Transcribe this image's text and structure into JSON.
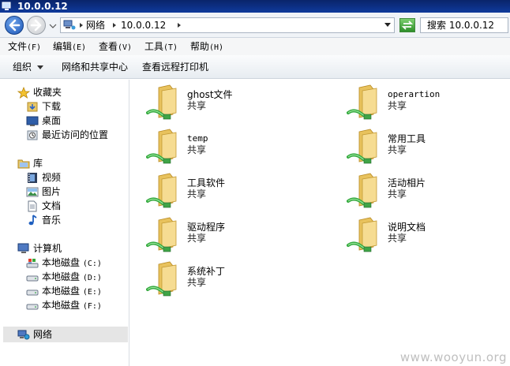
{
  "window": {
    "title": "10.0.0.12"
  },
  "address": {
    "crumbs": [
      "网络",
      "10.0.0.12"
    ],
    "search_text": "搜索 10.0.0.12"
  },
  "menu": [
    {
      "label": "文件",
      "key": "(F)"
    },
    {
      "label": "编辑",
      "key": "(E)"
    },
    {
      "label": "查看",
      "key": "(V)"
    },
    {
      "label": "工具",
      "key": "(T)"
    },
    {
      "label": "帮助",
      "key": "(H)"
    }
  ],
  "commands": {
    "organize": "组织",
    "network_center": "网络和共享中心",
    "remote_printers": "查看远程打印机"
  },
  "nav": {
    "favorites": {
      "label": "收藏夹",
      "items": [
        "下载",
        "桌面",
        "最近访问的位置"
      ]
    },
    "libraries": {
      "label": "库",
      "items": [
        "视频",
        "图片",
        "文档",
        "音乐"
      ]
    },
    "computer": {
      "label": "计算机",
      "items": [
        {
          "name": "本地磁盘",
          "drive": "(C:)"
        },
        {
          "name": "本地磁盘",
          "drive": "(D:)"
        },
        {
          "name": "本地磁盘",
          "drive": "(E:)"
        },
        {
          "name": "本地磁盘",
          "drive": "(F:)"
        }
      ]
    },
    "network": {
      "label": "网络"
    }
  },
  "shares": [
    {
      "name": "ghost文件",
      "type": "共享"
    },
    {
      "name": "operartion",
      "type": "共享"
    },
    {
      "name": "temp",
      "type": "共享"
    },
    {
      "name": "常用工具",
      "type": "共享"
    },
    {
      "name": "工具软件",
      "type": "共享"
    },
    {
      "name": "活动相片",
      "type": "共享"
    },
    {
      "name": "驱动程序",
      "type": "共享"
    },
    {
      "name": "说明文档",
      "type": "共享"
    },
    {
      "name": "系统补丁",
      "type": "共享"
    }
  ],
  "watermark": "www.wooyun.org",
  "colors": {
    "titlebar": "#0a246a",
    "folder": "#f2d27a",
    "share_pipe": "#35a93f"
  }
}
